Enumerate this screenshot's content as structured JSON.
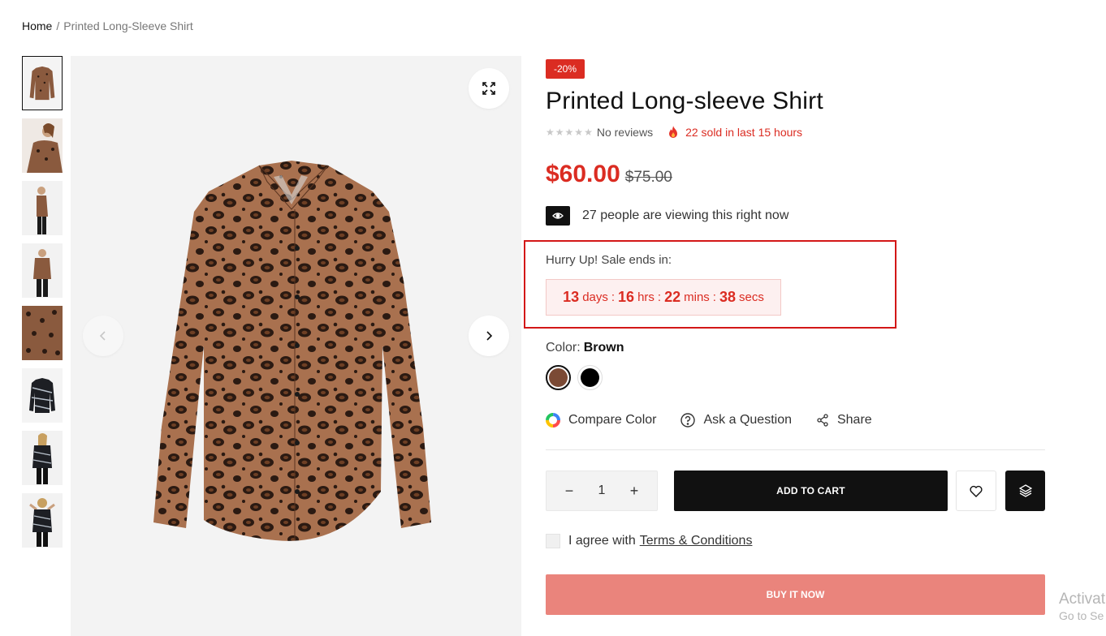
{
  "breadcrumb": {
    "home": "Home",
    "separator": "/",
    "current": "Printed Long-Sleeve Shirt"
  },
  "gallery": {
    "thumbnail_count": 8,
    "thumbnail_descriptions": [
      "leopard shirt flat",
      "model front",
      "model side",
      "model three-quarter",
      "fabric closeup",
      "black print shirt",
      "model black print",
      "model back"
    ]
  },
  "product": {
    "discount_badge": "-20%",
    "title": "Printed Long-sleeve Shirt",
    "reviews_text": "No reviews",
    "rating": 0,
    "rating_max": 5,
    "sold_text": "22 sold in last 15 hours",
    "price": "$60.00",
    "old_price": "$75.00",
    "viewers_text": "27 people are viewing this right now",
    "countdown": {
      "label": "Hurry Up! Sale ends in:",
      "days": "13",
      "days_unit": "days",
      "hrs": "16",
      "hrs_unit": "hrs",
      "mins": "22",
      "mins_unit": "mins",
      "secs": "38",
      "secs_unit": "secs",
      "separator": ":"
    },
    "color_label": "Color:",
    "color_value": "Brown",
    "swatches": [
      {
        "name": "Brown",
        "hex": "#7b4a35",
        "selected": true
      },
      {
        "name": "Black",
        "hex": "#000000",
        "selected": false
      }
    ]
  },
  "actions": {
    "compare": "Compare Color",
    "ask": "Ask a Question",
    "share": "Share"
  },
  "cart": {
    "quantity": "1",
    "minus": "−",
    "plus": "+",
    "add_to_cart": "ADD TO CART",
    "agree_text": "I agree with",
    "terms_link": "Terms & Conditions",
    "buy_now": "BUY IT NOW"
  },
  "colors": {
    "accent": "#db2c22",
    "buy_now": "#ea847c",
    "dark": "#111111"
  },
  "os_watermark": {
    "line1": "Activat",
    "line2": "Go to Se"
  }
}
